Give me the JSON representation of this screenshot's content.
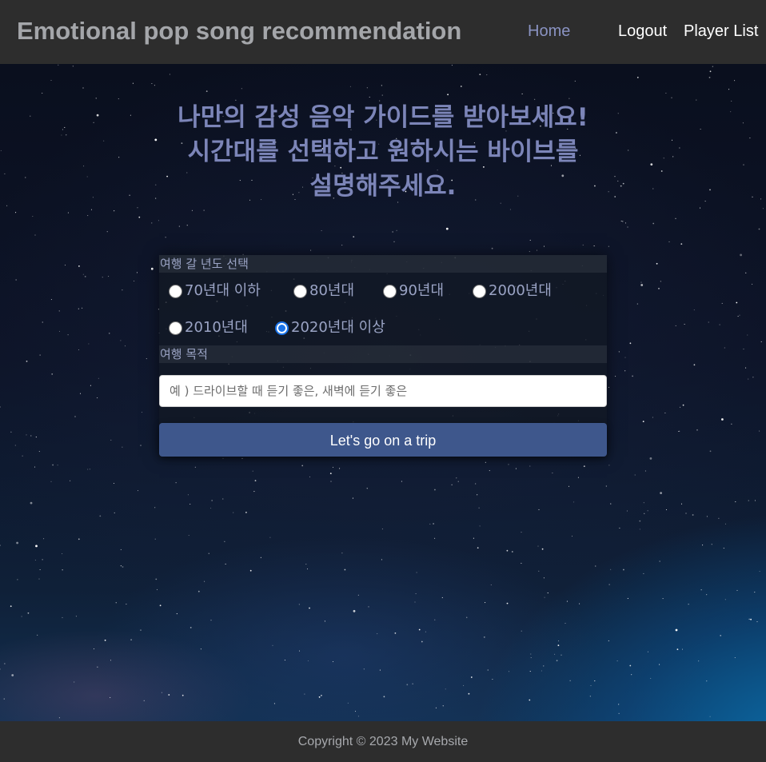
{
  "header": {
    "brand": "Emotional pop song recommendation",
    "nav": {
      "home": "Home",
      "logout": "Logout",
      "player_list": "Player List"
    }
  },
  "main": {
    "headline": {
      "line1": "나만의 감성 음악 가이드를 받아보세요!",
      "line2": "시간대를 선택하고 원하시는 바이브를",
      "line3": "설명해주세요."
    },
    "form": {
      "year_label": "여행 갈 년도 선택",
      "year_options": [
        {
          "label": "70년대 이하",
          "checked": false
        },
        {
          "label": "80년대",
          "checked": false
        },
        {
          "label": "90년대",
          "checked": false
        },
        {
          "label": "2000년대",
          "checked": false
        },
        {
          "label": "2010년대",
          "checked": false
        },
        {
          "label": "2020년대 이상",
          "checked": true
        }
      ],
      "purpose_label": "여행 목적",
      "purpose_placeholder": "예 ) 드라이브할 때 듣기 좋은, 새벽에 듣기 좋은",
      "purpose_value": "",
      "submit_label": "Let's go on a trip"
    }
  },
  "footer": {
    "copyright": "Copyright © 2023 My Website"
  },
  "colors": {
    "header_bg": "#2d2d2d",
    "brand_text": "#a4a6aa",
    "nav_active": "#8a93c2",
    "headline_text": "#7c85b8",
    "button_bg": "#3e578c",
    "radio_checked": "#1a73e8"
  }
}
